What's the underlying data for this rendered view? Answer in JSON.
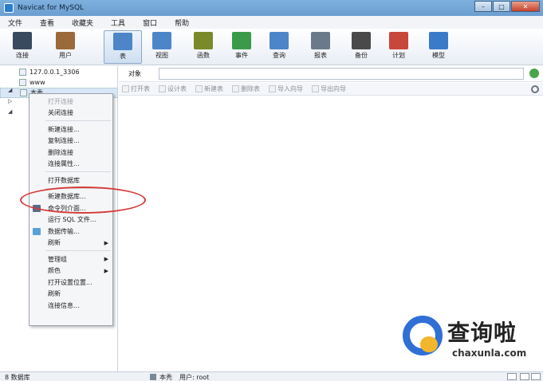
{
  "window": {
    "title": "Navicat for MySQL"
  },
  "menubar": [
    "文件",
    "查看",
    "收藏夹",
    "工具",
    "窗口",
    "帮助"
  ],
  "toolbar": [
    {
      "label": "连接",
      "icon": "plug-icon",
      "color": "#3a4a5e"
    },
    {
      "label": "用户",
      "icon": "user-icon",
      "color": "#9a6a3a"
    },
    {
      "label": "表",
      "icon": "table-icon",
      "color": "#4c86c8",
      "active": true
    },
    {
      "label": "视图",
      "icon": "view-icon",
      "color": "#4c86c8"
    },
    {
      "label": "函数",
      "icon": "function-icon",
      "color": "#7a8a2a"
    },
    {
      "label": "事件",
      "icon": "event-icon",
      "color": "#3a9a4a"
    },
    {
      "label": "查询",
      "icon": "query-icon",
      "color": "#4c86c8"
    },
    {
      "label": "报表",
      "icon": "report-icon",
      "color": "#6a7a8a"
    },
    {
      "label": "备份",
      "icon": "backup-icon",
      "color": "#4a4a4a"
    },
    {
      "label": "计划",
      "icon": "schedule-icon",
      "color": "#c8463a"
    },
    {
      "label": "模型",
      "icon": "model-icon",
      "color": "#3a7ac8"
    }
  ],
  "tree": [
    {
      "label": "127.0.0.1_3306"
    },
    {
      "label": "www"
    },
    {
      "label": "本秃",
      "selected": true
    }
  ],
  "context_menu": [
    {
      "label": "打开连接",
      "disabled": true
    },
    {
      "label": "关闭连接"
    },
    {
      "sep": true
    },
    {
      "label": "新建连接..."
    },
    {
      "label": "复制连接..."
    },
    {
      "label": "删除连接"
    },
    {
      "label": "连接属性..."
    },
    {
      "sep": true
    },
    {
      "label": "打开数据库"
    },
    {
      "sep": true
    },
    {
      "label": "新建数据库..."
    },
    {
      "label": "命令列介面...",
      "icon": "console-icon"
    },
    {
      "label": "运行 SQL 文件..."
    },
    {
      "label": "数据传输...",
      "icon": "transfer-icon"
    },
    {
      "label": "刷新",
      "submenu": true
    },
    {
      "sep": true
    },
    {
      "label": "管理组",
      "submenu": true
    },
    {
      "label": "颜色",
      "submenu": true
    },
    {
      "label": "打开设置位置..."
    },
    {
      "label": "刷新"
    },
    {
      "label": "连接信息..."
    }
  ],
  "object_bar": {
    "tab": "对象"
  },
  "object_toolbar": [
    "打开表",
    "设计表",
    "新建表",
    "删除表",
    "导入向导",
    "导出向导"
  ],
  "statusbar": {
    "count": "8 数据库",
    "connection": "本秃",
    "user": "用户: root"
  },
  "watermark": {
    "text": "查询啦",
    "url": "chaxunla.com"
  }
}
